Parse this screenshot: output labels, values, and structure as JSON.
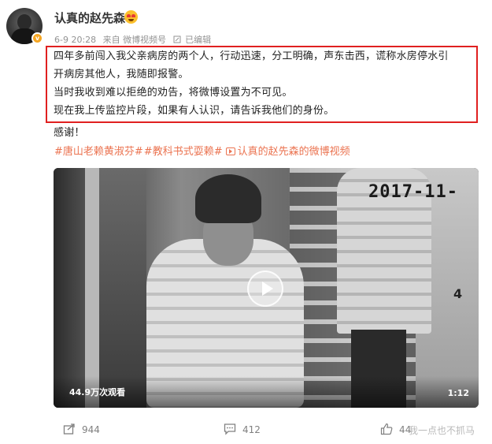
{
  "post": {
    "author": "认真的赵先森",
    "meta": {
      "date": "6-9 20:28",
      "source": "来自 微博视频号",
      "edited": "已编辑"
    },
    "paragraphs": [
      "四年多前闯入我父亲病房的两个人，行动迅速，分工明确，声东击西，谎称水房停水引",
      "开病房其他人，我随即报警。",
      "当时我收到难以拒绝的劝告，将微博设置为不可见。",
      "现在我上传监控片段，如果有人认识，请告诉我他们的身份。",
      "感谢！"
    ],
    "tags": [
      "#唐山老赖黄淑芬#",
      "#教科书式耍赖#",
      "认真的赵先森的微博视频"
    ],
    "video": {
      "timestamp": "2017-11-",
      "camera_number": "4",
      "views": "44.9万次观看",
      "duration": "1:12"
    },
    "actions": {
      "share_count": "944",
      "comment_count": "412",
      "like_count": "44"
    },
    "watermark": "我一点也不抓马"
  },
  "colors": {
    "highlight_border": "#e02020",
    "tag_color": "#eb7350",
    "meta_color": "#939393"
  }
}
